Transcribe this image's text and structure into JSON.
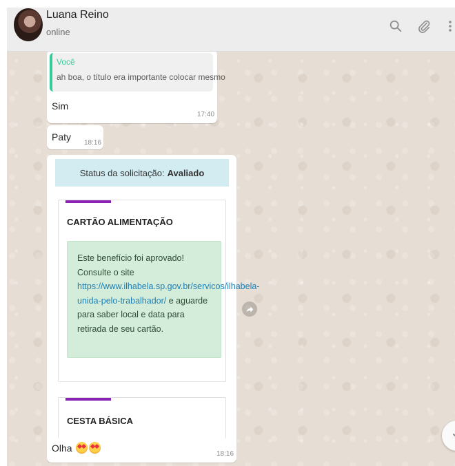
{
  "header": {
    "contact_name": "Luana Reino",
    "contact_status": "online",
    "icons": [
      "search-icon",
      "attach-icon",
      "menu-icon"
    ]
  },
  "messages": {
    "reply": {
      "quote_author": "Você",
      "quote_text": "ah boa, o título era importante colocar mesmo",
      "text": "Sim",
      "time": "17:40"
    },
    "paty": {
      "text": "Paty",
      "time": "18:16"
    },
    "card_message": {
      "status_prefix": "Status da solicitação:",
      "status_value": "Avaliado",
      "card1_title": "CARTÃO ALIMENTAÇÃO",
      "card1_body_before": "Este benefício foi aprovado! Consulte o site",
      "card1_link": "https://www.ilhabela.sp.gov.br/servicos/ilhabela-unida-pelo-trabalhador/",
      "card1_body_after": " e aguarde para saber local e data para retirada de seu cartão.",
      "card2_title": "CESTA BÁSICA",
      "caption": "Olha",
      "time": "18:16"
    }
  },
  "colors": {
    "quote_accent": "#35cd96",
    "card_accent": "#8a22b5",
    "status_bg": "#d3ecf1",
    "approved_bg": "#d4edda",
    "link": "#1e7eb5"
  }
}
